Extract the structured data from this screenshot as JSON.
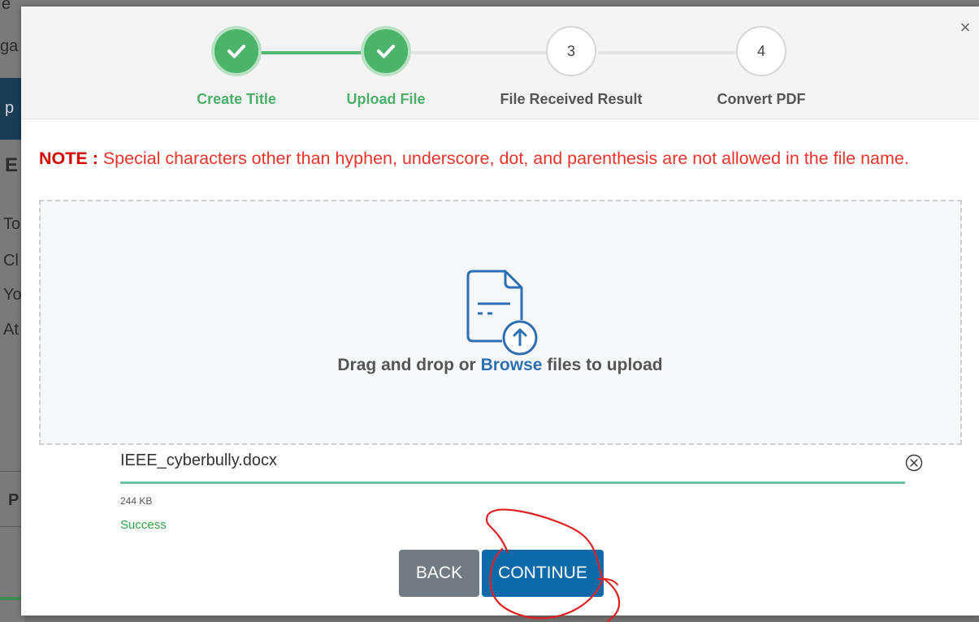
{
  "background": {
    "fragments": [
      "e",
      "ga",
      "p",
      "E",
      "To",
      "Cl",
      "Yo",
      "At",
      "P"
    ]
  },
  "stepper": {
    "steps": [
      {
        "label": "Create Title",
        "number": "1",
        "status": "done"
      },
      {
        "label": "Upload File",
        "number": "2",
        "status": "done"
      },
      {
        "label": "File Received Result",
        "number": "3",
        "status": "pending"
      },
      {
        "label": "Convert PDF",
        "number": "4",
        "status": "pending"
      }
    ]
  },
  "note": {
    "prefix": "NOTE :",
    "text": " Special characters other than hyphen, underscore, dot, and parenthesis are not allowed in the file name."
  },
  "dropzone": {
    "text_before": "Drag and drop or ",
    "browse": "Browse",
    "text_after": " files to upload",
    "icon": "file-upload-icon"
  },
  "file": {
    "name": "IEEE_cyberbully.docx",
    "size": "244 KB",
    "status": "Success",
    "progress": 1.0
  },
  "buttons": {
    "back": "BACK",
    "continue": "CONTINUE"
  },
  "close": "×",
  "colors": {
    "accent_green": "#4cb36b",
    "note_red": "#e8332b",
    "primary_blue": "#0d6aa8",
    "browse_blue": "#2e6fb1",
    "success_green": "#2ea344",
    "annotation_red": "#e02020"
  }
}
